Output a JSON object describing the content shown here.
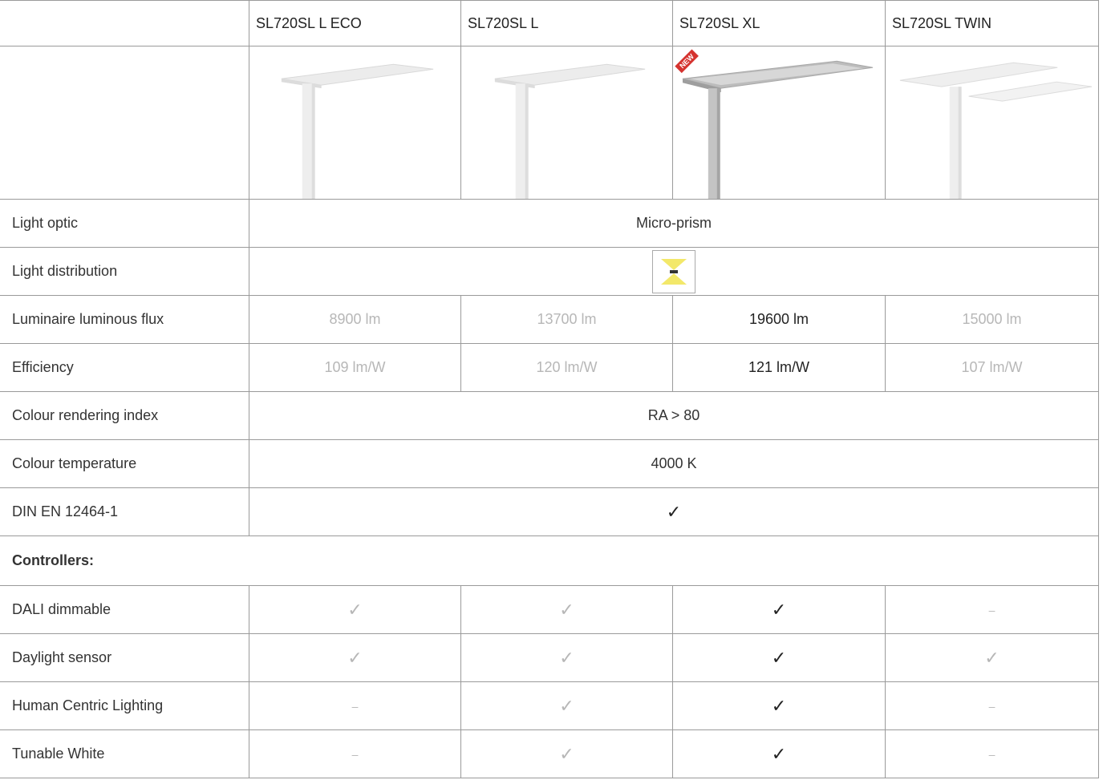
{
  "columns": [
    "SL720SL L ECO",
    "SL720SL L",
    "SL720SL XL",
    "SL720SL TWIN"
  ],
  "new_badge": "NEW",
  "light_optic": {
    "label": "Light optic",
    "value": "Micro-prism"
  },
  "light_distribution": {
    "label": "Light distribution",
    "icon": "direct-indirect-light-icon"
  },
  "flux": {
    "label": "Luminaire luminous flux",
    "values": [
      "8900 lm",
      "13700 lm",
      "19600 lm",
      "15000 lm"
    ]
  },
  "efficiency": {
    "label": "Efficiency",
    "values": [
      "109 lm/W",
      "120 lm/W",
      "121 lm/W",
      "107 lm/W"
    ]
  },
  "cri": {
    "label": "Colour rendering index",
    "value": "RA > 80"
  },
  "temperature": {
    "label": "Colour temperature",
    "value": "4000 K"
  },
  "din": {
    "label": "DIN EN 12464-1",
    "value": "✓"
  },
  "controllers": {
    "label": "Controllers:"
  },
  "dali": {
    "label": "DALI dimmable",
    "values": [
      "✓",
      "✓",
      "✓",
      "–"
    ]
  },
  "daylight": {
    "label": "Daylight sensor",
    "values": [
      "✓",
      "✓",
      "✓",
      "✓"
    ]
  },
  "hcl": {
    "label": "Human Centric Lighting",
    "values": [
      "–",
      "✓",
      "✓",
      "–"
    ]
  },
  "tunable": {
    "label": "Tunable White",
    "values": [
      "–",
      "✓",
      "✓",
      "–"
    ]
  },
  "colors": {
    "text_dim": "#b7b7b7",
    "text_dark": "#222222",
    "border": "#9a9a9a",
    "accent_yellow": "#f3e86a",
    "badge_red": "#d5332f"
  }
}
